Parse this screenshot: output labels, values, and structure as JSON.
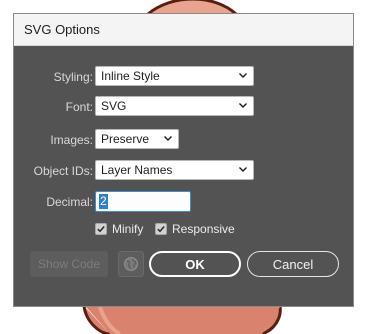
{
  "dialog": {
    "title": "SVG Options"
  },
  "fields": {
    "styling": {
      "label": "Styling:",
      "value": "Inline Style"
    },
    "font": {
      "label": "Font:",
      "value": "SVG"
    },
    "images": {
      "label": "Images:",
      "value": "Preserve"
    },
    "object_ids": {
      "label": "Object IDs:",
      "value": "Layer Names"
    },
    "decimal": {
      "label": "Decimal:",
      "value": "2"
    }
  },
  "checkboxes": {
    "minify": {
      "label": "Minify",
      "checked": true
    },
    "responsive": {
      "label": "Responsive",
      "checked": true
    }
  },
  "buttons": {
    "show_code": "Show Code",
    "ok": "OK",
    "cancel": "Cancel",
    "globe_icon": "globe-icon"
  },
  "colors": {
    "dialog_bg": "#535353",
    "titlebar_bg": "#f4f4f4",
    "focus_accent": "#3b8fd6",
    "artwork_fill": "#d9826e",
    "artwork_stroke": "#5a1f14"
  }
}
